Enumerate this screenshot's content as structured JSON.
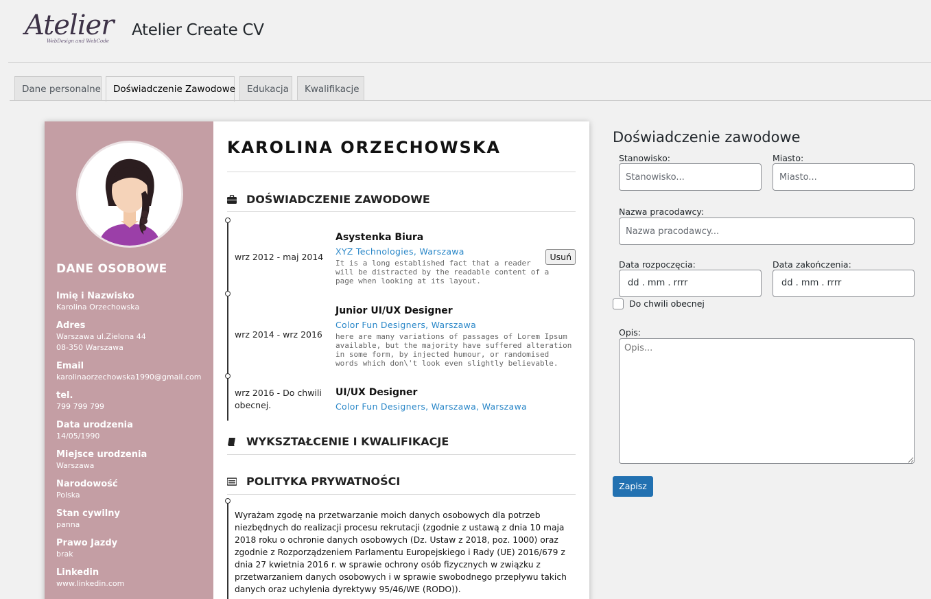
{
  "header": {
    "logo_text": "Atelier",
    "logo_sub": "WebDesign and WebCode",
    "title": "Atelier Create CV"
  },
  "tabs": [
    {
      "label": "Dane personalne"
    },
    {
      "label": "Doświadczenie Zawodowe",
      "active": true
    },
    {
      "label": "Edukacja"
    },
    {
      "label": "Kwalifikacje"
    }
  ],
  "cv": {
    "name": "KAROLINA ORZECHOWSKA",
    "sidebar_color": "#c49ea4",
    "personal_heading": "DANE OSOBOWE",
    "personal": [
      {
        "label": "Imię i Nazwisko",
        "value": "Karolina Orzechowska"
      },
      {
        "label": "Adres",
        "value": "Warszawa ul.Zielona 44\n08-350 Warszawa"
      },
      {
        "label": "Email",
        "value": "karolinaorzechowska1990@gmail.com"
      },
      {
        "label": "tel.",
        "value": "799 799 799"
      },
      {
        "label": "Data urodzenia",
        "value": "14/05/1990"
      },
      {
        "label": "Miejsce urodzenia",
        "value": "Warszawa"
      },
      {
        "label": "Narodowość",
        "value": "Polska"
      },
      {
        "label": "Stan cywilny",
        "value": "panna"
      },
      {
        "label": "Prawo Jazdy",
        "value": "brak"
      },
      {
        "label": "Linkedin",
        "value": "www.linkedin.com"
      }
    ],
    "experience_heading": "DOŚWIADCZENIE ZAWODOWE",
    "jobs": [
      {
        "date": "wrz 2012 - maj 2014",
        "title": "Asystenka Biura",
        "company": "XYZ Technologies, Warszawa",
        "desc": "It is a long established fact that a reader will be distracted by the readable content of a page when looking at its layout.",
        "delete_label": "Usuń"
      },
      {
        "date": "wrz 2014 - wrz 2016",
        "title": "Junior UI/UX Designer",
        "company": "Color Fun Designers, Warszawa",
        "desc": "here are many variations of passages of Lorem Ipsum available, but the majority have suffered alteration in some form, by injected humour, or randomised words which don\\'t look even slightly believable."
      },
      {
        "date": "wrz 2016 - Do chwili obecnej.",
        "title": "UI/UX Designer",
        "company": "Color Fun Designers, Warszawa, Warszawa",
        "desc": ""
      }
    ],
    "education_heading": "WYKSZTAŁCENIE I KWALIFIKACJE",
    "privacy_heading": "POLITYKA PRYWATNOŚCI",
    "privacy_text": "Wyrażam zgodę na przetwarzanie moich danych osobowych dla potrzeb niezbędnych do realizacji procesu rekrutacji (zgodnie z ustawą z dnia 10 maja 2018 roku o ochronie danych osobowych (Dz. Ustaw z 2018, poz. 1000) oraz zgodnie z Rozporządzeniem Parlamentu Europejskiego i Rady (UE) 2016/679 z dnia 27 kwietnia 2016 r. w sprawie ochrony osób fizycznych w związku z przetwarzaniem danych osobowych i w sprawie swobodnego przepływu takich danych oraz uchylenia dyrektywy 95/46/WE (RODO))."
  },
  "form": {
    "title": "Doświadczenie zawodowe",
    "position_label": "Stanowisko:",
    "position_placeholder": "Stanowisko...",
    "city_label": "Miasto:",
    "city_placeholder": "Miasto...",
    "employer_label": "Nazwa pracodawcy:",
    "employer_placeholder": "Nazwa pracodawcy...",
    "start_label": "Data rozpoczęcia:",
    "start_value": "dd . mm . rrrr",
    "end_label": "Data zakończenia:",
    "end_value": "dd . mm . rrrr",
    "current_label": "Do chwili obecnej",
    "desc_label": "Opis:",
    "desc_placeholder": "Opis...",
    "save_label": "Zapisz",
    "accent_color": "#2271b1"
  }
}
